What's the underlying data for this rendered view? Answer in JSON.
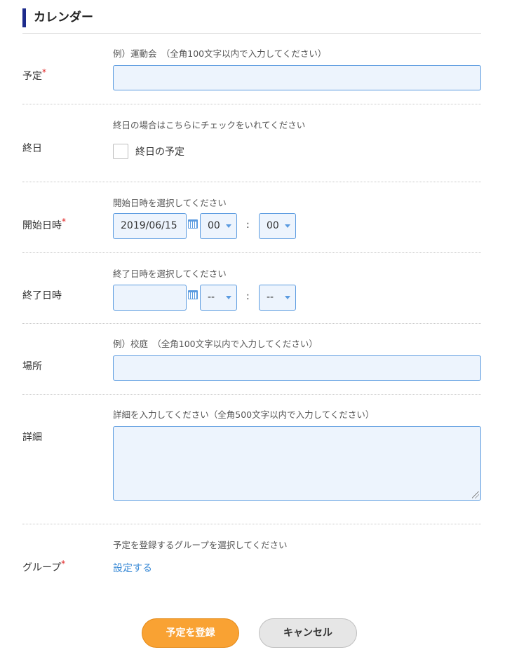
{
  "header": {
    "title": "カレンダー"
  },
  "fields": {
    "title": {
      "label": "予定",
      "required_mark": "*",
      "hint": "例）運動会　（全角100文字以内で入力してください）",
      "value": ""
    },
    "all_day": {
      "label": "終日",
      "hint": "終日の場合はこちらにチェックをいれてください",
      "checkbox_label": "終日の予定",
      "checked": false
    },
    "start": {
      "label": "開始日時",
      "required_mark": "*",
      "hint": "開始日時を選択してください",
      "date": "2019/06/15",
      "hour": "00",
      "minute": "00",
      "separator": ":"
    },
    "end": {
      "label": "終了日時",
      "hint": "終了日時を選択してください",
      "date": "",
      "hour": "--",
      "minute": "--",
      "separator": ":"
    },
    "place": {
      "label": "場所",
      "hint": "例）校庭　（全角100文字以内で入力してください）",
      "value": ""
    },
    "details": {
      "label": "詳細",
      "hint": "詳細を入力してください（全角500文字以内で入力してください）",
      "value": ""
    },
    "group": {
      "label": "グループ",
      "required_mark": "*",
      "hint": "予定を登録するグループを選択してください",
      "link": "設定する"
    }
  },
  "buttons": {
    "submit": "予定を登録",
    "cancel": "キャンセル"
  },
  "colors": {
    "accent_bar": "#1d2b8c",
    "input_border": "#5b9be0",
    "input_bg": "#edf4fd",
    "required": "#e02020",
    "link": "#3a8ad6",
    "primary_button": "#f9a233"
  }
}
